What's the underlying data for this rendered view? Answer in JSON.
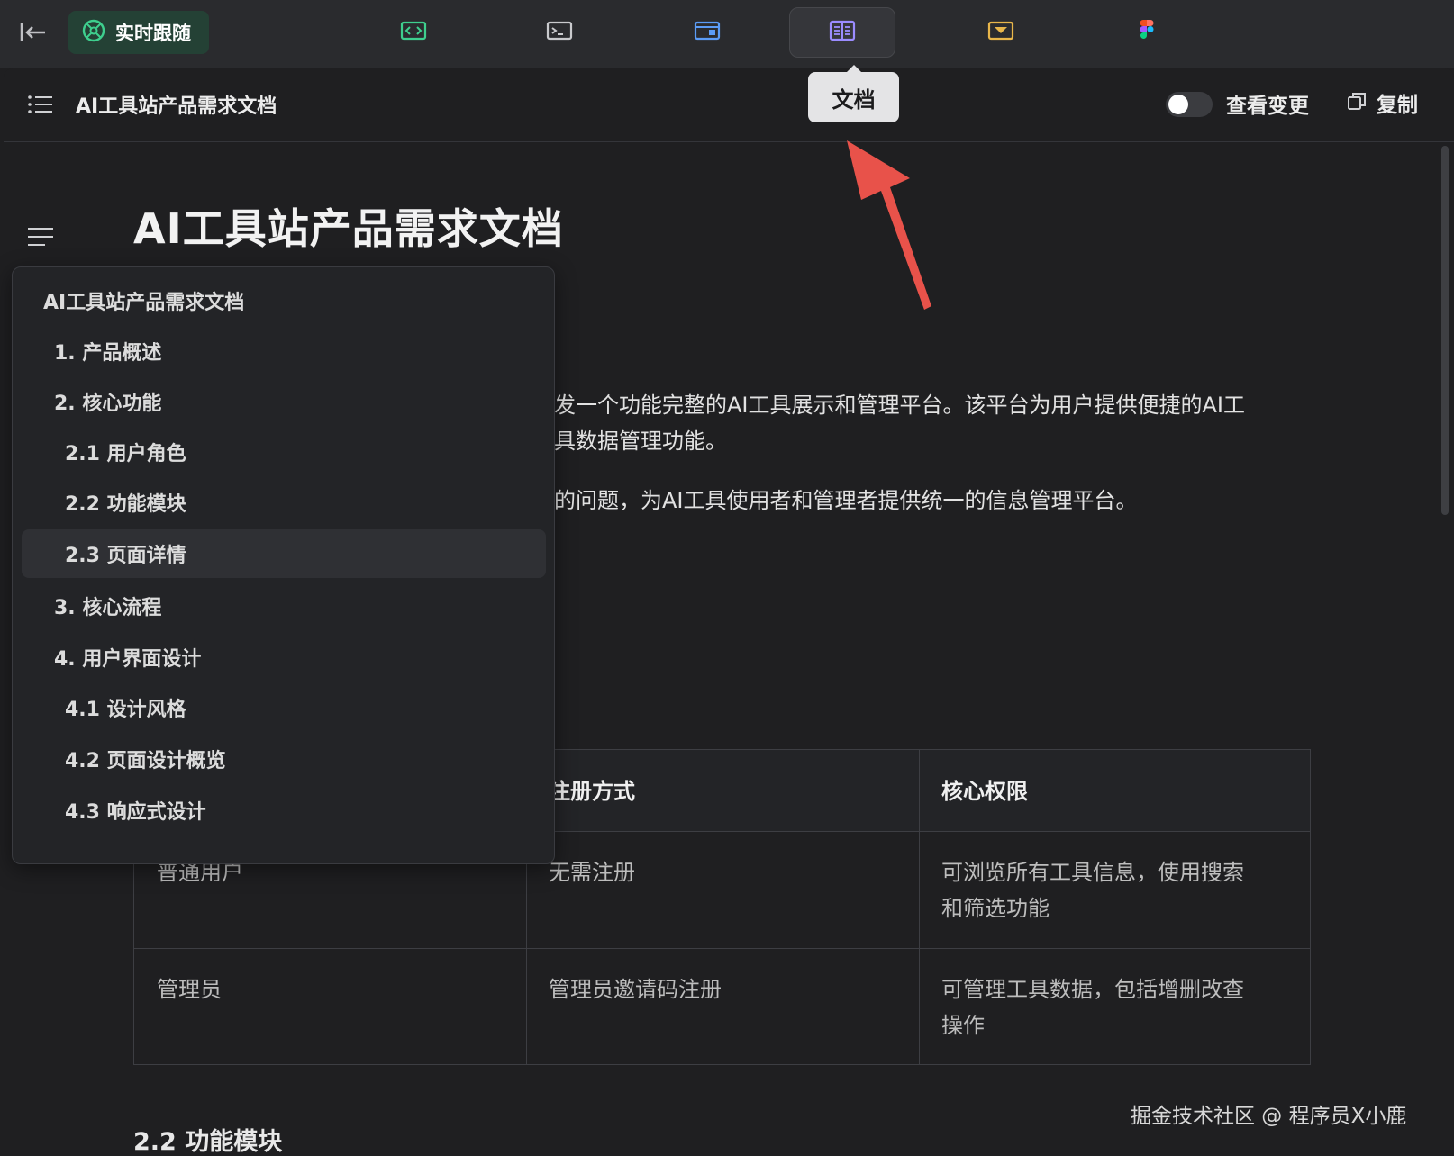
{
  "toolbar": {
    "follow_label": "实时跟随",
    "active_tool_tooltip": "文档"
  },
  "doc_header": {
    "title": "AI工具站产品需求文档",
    "view_changes_label": "查看变更",
    "copy_label": "复制"
  },
  "document": {
    "title": "AI工具站产品需求文档",
    "para1_line1": "发一个功能完整的AI工具展示和管理平台。该平台为用户提供便捷的AI工",
    "para1_line2": "具数据管理功能。",
    "para2": "的问题，为AI工具使用者和管理者提供统一的信息管理平台。",
    "table": {
      "headers": [
        "注册方式",
        "核心权限"
      ],
      "rows": [
        [
          "普通用户",
          "无需注册",
          "可浏览所有工具信息，使用搜索",
          "和筛选功能"
        ],
        [
          "管理员",
          "管理员邀请码注册",
          "可管理工具数据，包括增删改查",
          "操作"
        ]
      ]
    },
    "next_heading": "2.2 功能模块"
  },
  "toc": {
    "items": [
      {
        "label": "AI工具站产品需求文档"
      },
      {
        "label": "1. 产品概述"
      },
      {
        "label": "2. 核心功能"
      },
      {
        "label": "2.1 用户角色"
      },
      {
        "label": "2.2 功能模块"
      },
      {
        "label": "2.3 页面详情"
      },
      {
        "label": "3. 核心流程"
      },
      {
        "label": "4. 用户界面设计"
      },
      {
        "label": "4.1 设计风格"
      },
      {
        "label": "4.2 页面设计概览"
      },
      {
        "label": "4.3 响应式设计"
      }
    ]
  },
  "watermark": "掘金技术社区 @ 程序员X小鹿",
  "colors": {
    "follow_bg": "#244135",
    "follow_icon": "#3ecf8e",
    "code_icon": "#3ecf8e",
    "preview_icon": "#5b9cf6",
    "doc_icon": "#9b8cff",
    "db_icon": "#e8b64a",
    "annotation_arrow": "#e8524a"
  }
}
